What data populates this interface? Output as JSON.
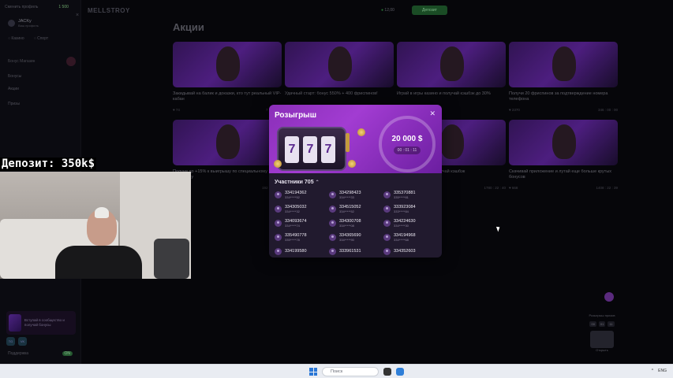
{
  "sidebar": {
    "header_left": "Сменить профиль",
    "header_balance": "1 500",
    "user_name": "JACKy",
    "user_sub": "Ваш профиль",
    "tabs": [
      "Казино",
      "Спорт"
    ],
    "section_label": "Бонус Магазин",
    "items": [
      "Бонусы",
      "Акции",
      "Призы"
    ],
    "promo_text": "Вступай в сообщество и получай бонусы",
    "socials": [
      "TG",
      "VK"
    ],
    "bottom_label": "Поддержка",
    "bottom_toggle": "ON"
  },
  "topbar": {
    "logo": "MELLSTROY",
    "balance": "12,00",
    "deposit_label": "Депозит"
  },
  "page": {
    "title": "Акции",
    "cards": [
      {
        "title": "Закидывай на балик и доказки, кто тут реальный VIP-кабан",
        "left": "♥ 74",
        "right": "7 : 00 : 00"
      },
      {
        "title": "Удачный старт: бонус 550% + 400 фриспинов!",
        "left": "",
        "right": ""
      },
      {
        "title": "Играй в игры казино и получай кэшбэк до 30%",
        "left": "",
        "right": ""
      },
      {
        "title": "Получи 20 фриспинов за подтверждение номера телефона",
        "left": "♥ 2370",
        "right": "346 : 00 : 00"
      },
      {
        "title": "Получи до +15% к выигрышу по специальному выигрышу",
        "left": "",
        "right": "192 : 21 : 33"
      },
      {
        "title": "",
        "left": "",
        "right": ""
      },
      {
        "title": "Играй на слоты и получай кэшбэк",
        "left": "",
        "right": "1780 : 22 : 40"
      },
      {
        "title": "Скачивай приложение и лутай еще больше крутых бонусов",
        "left": "♥ 668",
        "right": "1408 : 22 : 39"
      }
    ]
  },
  "modal": {
    "title": "Розыгрыш",
    "prize": "20 000 $",
    "timer": "00 : 01 : 11",
    "participants_label": "Участники 705",
    "participants": [
      {
        "id": "334194362",
        "mask": "334*****52"
      },
      {
        "id": "334298423",
        "mask": "334*****33"
      },
      {
        "id": "335370881",
        "mask": "335*****81"
      },
      {
        "id": "334305032",
        "mask": "334*****32"
      },
      {
        "id": "334515052",
        "mask": "334*****52"
      },
      {
        "id": "333923084",
        "mask": "333*****84"
      },
      {
        "id": "334093674",
        "mask": "334*****74"
      },
      {
        "id": "334300708",
        "mask": "334*****08"
      },
      {
        "id": "334224630",
        "mask": "334*****30"
      },
      {
        "id": "335490778",
        "mask": "335*****78"
      },
      {
        "id": "334365690",
        "mask": "334*****90"
      },
      {
        "id": "334194968",
        "mask": "334*****68"
      },
      {
        "id": "334199580",
        "mask": ""
      },
      {
        "id": "333961531",
        "mask": ""
      },
      {
        "id": "334352603",
        "mask": ""
      }
    ]
  },
  "stream": {
    "deposit_overlay": "Депозит: 350k$"
  },
  "rewards": {
    "label": "Розыгрыш призов",
    "timer": [
      "00",
      "01",
      "11"
    ],
    "gift_label": "Открыть"
  },
  "taskbar": {
    "search_placeholder": "Поиск",
    "tray": [
      "^",
      "ENG"
    ]
  }
}
